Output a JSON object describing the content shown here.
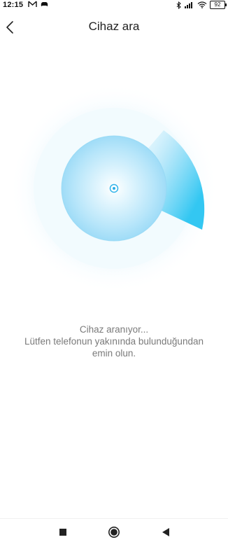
{
  "status_bar": {
    "time": "12:15",
    "left_icons": [
      "gmail-icon",
      "game-icon"
    ],
    "right_icons": [
      "bluetooth-icon",
      "signal-icon",
      "wifi-icon"
    ],
    "battery": "92"
  },
  "header": {
    "title": "Cihaz ara",
    "back_icon": "chevron-left-icon"
  },
  "message": {
    "line1": "Cihaz aranıyor...",
    "line2": "Lütfen telefonun yakınında bulunduğundan",
    "line3": "emin olun."
  },
  "navbar": {
    "icons": [
      "recents-square-icon",
      "home-circle-icon",
      "back-triangle-icon"
    ]
  },
  "colors": {
    "accent": "#33c7f2",
    "radar_light": "#bfe9fb",
    "text_secondary": "#7a7a7a"
  }
}
